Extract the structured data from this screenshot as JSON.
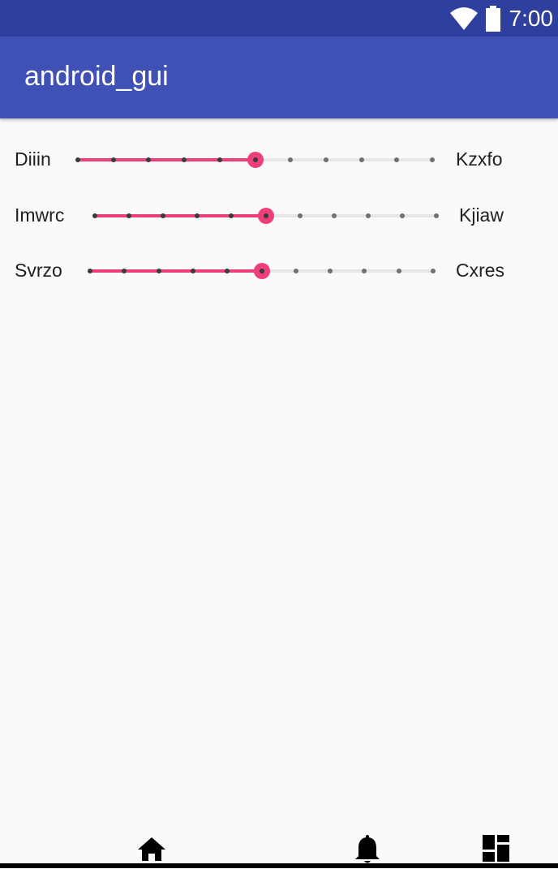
{
  "status_bar": {
    "time": "7:00",
    "icons": [
      "wifi-icon",
      "battery-icon"
    ]
  },
  "app_bar": {
    "title": "android_gui"
  },
  "sliders": [
    {
      "left_label": "Diiin",
      "right_label": "Kzxfo",
      "steps": 10,
      "value": 5
    },
    {
      "left_label": "Imwrc",
      "right_label": "Kjiaw",
      "steps": 10,
      "value": 5
    },
    {
      "left_label": "Svrzo",
      "right_label": "Cxres",
      "steps": 10,
      "value": 5
    }
  ],
  "bottom_nav": {
    "items": [
      "home-icon",
      "notifications-icon",
      "dashboard-icon"
    ]
  },
  "colors": {
    "status_bar": "#2f3f9e",
    "app_bar": "#3f51b5",
    "accent": "#ee3f7a",
    "background": "#fafafa"
  }
}
